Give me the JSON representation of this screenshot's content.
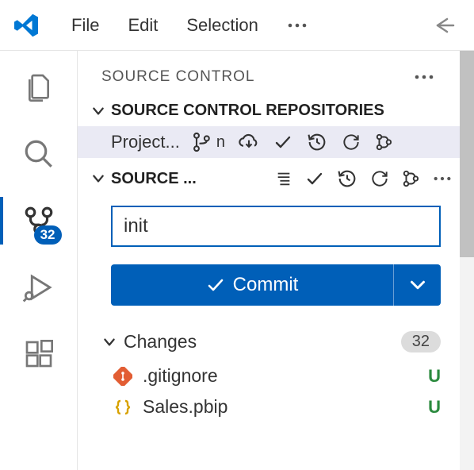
{
  "menu": {
    "file": "File",
    "edit": "Edit",
    "selection": "Selection"
  },
  "activity": {
    "scm_badge": "32"
  },
  "panel": {
    "title": "SOURCE CONTROL",
    "repos_section": "SOURCE CONTROL REPOSITORIES",
    "repo_name": "Project...",
    "branch_label": "n",
    "sc_section": "SOURCE ...",
    "commit_msg": "init",
    "commit_btn": "Commit",
    "changes_title": "Changes",
    "changes_count": "32",
    "files": [
      {
        "name": ".gitignore",
        "status": "U",
        "icon": "git"
      },
      {
        "name": "Sales.pbip",
        "status": "U",
        "icon": "braces"
      }
    ]
  }
}
